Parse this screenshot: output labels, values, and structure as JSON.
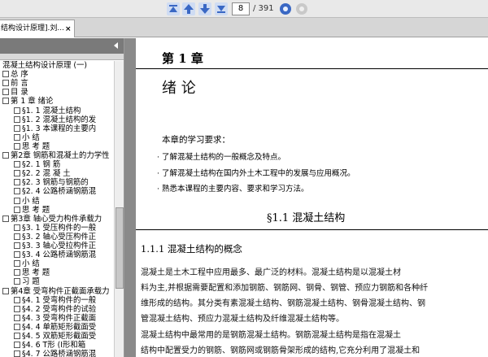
{
  "toolbar": {
    "first_page_icon": "first-page-icon",
    "prev_page_icon": "previous-page-icon",
    "next_page_icon": "next-page-icon",
    "last_page_icon": "last-page-icon",
    "current_page": "8",
    "total_pages": "/ 391",
    "back_icon": "back-icon",
    "forward_icon": "forward-icon",
    "accent_color": "#3a68c4"
  },
  "tab": {
    "label": "结构设计原理].刘...",
    "close": "×"
  },
  "sidebar": {
    "collapse_icon": "collapse-left-icon",
    "items": [
      {
        "label": "混凝土结构设计原理 (一)"
      },
      {
        "label": "总   序"
      },
      {
        "label": "前   言"
      },
      {
        "label": "目   录"
      },
      {
        "label": "第 1 章    绪论"
      },
      {
        "label": "§1. 1   混凝土结构"
      },
      {
        "label": "§1. 2   混凝土结构的发"
      },
      {
        "label": "§1. 3   本课程的主要内"
      },
      {
        "label": "小    结"
      },
      {
        "label": "思  考  题"
      },
      {
        "label": "第2章    钢筋和混凝土的力学性"
      },
      {
        "label": "§2. 1   钢    筋"
      },
      {
        "label": "§2. 2   混    凝    土"
      },
      {
        "label": "§2. 3   钢筋与钢筋的"
      },
      {
        "label": "§2. 4   公路桥涵钢筋混"
      },
      {
        "label": "小    结"
      },
      {
        "label": "思  考  题"
      },
      {
        "label": "第3章    轴心受力构件承载力"
      },
      {
        "label": "§3. 1   受压构件的一般"
      },
      {
        "label": "§3. 2   轴心受压构件正"
      },
      {
        "label": "§3. 3   轴心受拉构件正"
      },
      {
        "label": "§3. 4   公路桥涵钢筋混"
      },
      {
        "label": "小    结"
      },
      {
        "label": "思  考  题"
      },
      {
        "label": "习    题"
      },
      {
        "label": "第4章    受弯构件正截面承载力"
      },
      {
        "label": "§4. 1   受弯构件的一般"
      },
      {
        "label": "§4. 2   受弯构件的试验"
      },
      {
        "label": "§4. 3   受弯构件正截面"
      },
      {
        "label": "§4. 4   单筋矩形截面受"
      },
      {
        "label": "§4. 5   双筋矩形截面受"
      },
      {
        "label": "§4. 6   T形 (I形和箱"
      },
      {
        "label": "§4. 7   公路桥涵钢筋混"
      }
    ]
  },
  "document": {
    "chapter_number": "第 1 章",
    "chapter_title": "绪 论",
    "requirements_heading": "本章的学习要求：",
    "requirements": [
      "· 了解混凝土结构的一般概念及特点。",
      "· 了解混凝土结构在国内外土木工程中的发展与应用概况。",
      "· 熟悉本课程的主要内容、要求和学习方法。"
    ],
    "section_title": "§1.1    混凝土结构",
    "subsection_title": "1.1.1    混凝土结构的概念",
    "paragraph_lines": [
      "        混凝土是土木工程中应用最多、最广泛的材料。混凝土结构是以混凝土材",
      "料为主,并根据需要配置和添加钢筋、钢筋网、钢骨、钢管、预应力钢筋和各种纤",
      "维形成的结构。其分类有素混凝土结构、钢筋混凝土结构、钢骨混凝土结构、钢",
      "管混凝土结构、预应力混凝土结构及纤维混凝土结构等。",
      "        混凝土结构中最常用的是钢筋混凝土结构。钢筋混凝土结构是指在混凝土",
      "结构中配置受力的钢筋、钢筋网或钢筋骨架形成的结构,它充分利用了混凝土和"
    ]
  }
}
